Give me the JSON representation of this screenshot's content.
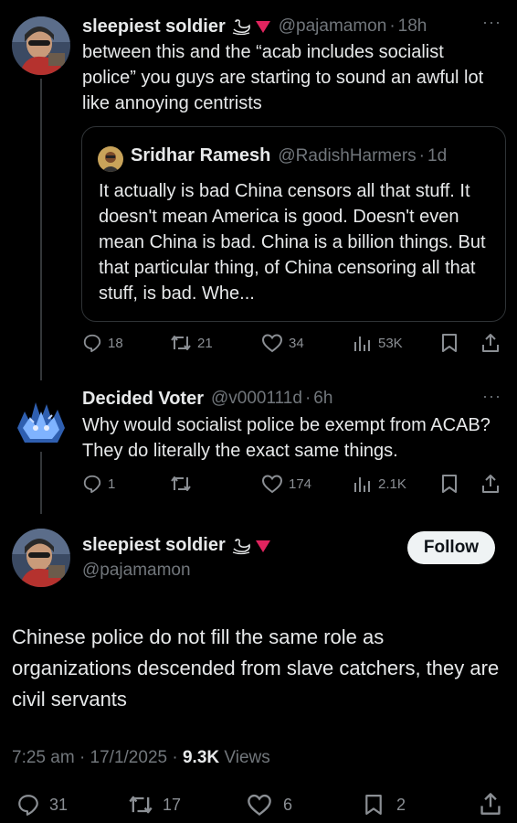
{
  "tweet1": {
    "name": "sleepiest soldier",
    "handle": "@pajamamon",
    "time": "18h",
    "text": "between this and the “acab includes socialist police” you guys are starting to sound an awful lot like annoying centrists",
    "quote": {
      "name": "Sridhar Ramesh",
      "handle": "@RadishHarmers",
      "time": "1d",
      "text": "It actually is bad China censors all that stuff. It doesn't mean America is good. Doesn't even mean China is bad. China is a billion things. But that particular thing, of China censoring all that stuff, is bad. Whe..."
    },
    "replies": "18",
    "reposts": "21",
    "likes": "34",
    "views": "53K"
  },
  "tweet2": {
    "name": "Decided Voter",
    "handle": "@v000111d",
    "time": "6h",
    "text": "Why would socialist police be exempt from ACAB? They do literally the exact same things.",
    "replies": "1",
    "reposts": "",
    "likes": "174",
    "views": "2.1K"
  },
  "main": {
    "name": "sleepiest soldier",
    "handle": "@pajamamon",
    "follow_label": "Follow",
    "text": "Chinese police do not fill the same role as organizations descended from slave catchers, they are civil servants",
    "time": "7:25 am",
    "date": "17/1/2025",
    "views_count": "9.3K",
    "views_label": "Views",
    "replies": "31",
    "reposts": "17",
    "likes": "6",
    "bookmarks": "2"
  },
  "colors": {
    "accent_red": "#e0245e",
    "muted": "#71767b",
    "bg": "#000000"
  },
  "icons": [
    "reply-icon",
    "repost-icon",
    "like-icon",
    "views-icon",
    "bookmark-icon",
    "share-icon",
    "more-icon",
    "swan-emoji-icon",
    "red-triangle-icon"
  ]
}
